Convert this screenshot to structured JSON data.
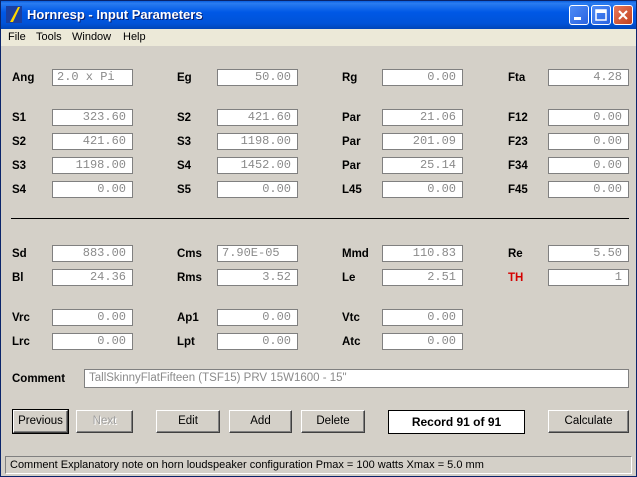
{
  "window": {
    "title": "Hornresp - Input Parameters"
  },
  "menu": [
    "File",
    "Tools",
    "Window",
    "Help"
  ],
  "rows": {
    "r1": [
      {
        "label": "Ang",
        "value": "2.0 x Pi",
        "align": "left"
      },
      {
        "label": "Eg",
        "value": "50.00"
      },
      {
        "label": "Rg",
        "value": "0.00"
      },
      {
        "label": "Fta",
        "value": "4.28"
      }
    ],
    "r2": [
      {
        "label": "S1",
        "value": "323.60"
      },
      {
        "label": "S2",
        "value": "421.60"
      },
      {
        "label": "Par",
        "value": "21.06"
      },
      {
        "label": "F12",
        "value": "0.00"
      }
    ],
    "r3": [
      {
        "label": "S2",
        "value": "421.60"
      },
      {
        "label": "S3",
        "value": "1198.00"
      },
      {
        "label": "Par",
        "value": "201.09"
      },
      {
        "label": "F23",
        "value": "0.00"
      }
    ],
    "r4": [
      {
        "label": "S3",
        "value": "1198.00"
      },
      {
        "label": "S4",
        "value": "1452.00"
      },
      {
        "label": "Par",
        "value": "25.14"
      },
      {
        "label": "F34",
        "value": "0.00"
      }
    ],
    "r5": [
      {
        "label": "S4",
        "value": "0.00"
      },
      {
        "label": "S5",
        "value": "0.00"
      },
      {
        "label": "L45",
        "value": "0.00"
      },
      {
        "label": "F45",
        "value": "0.00"
      }
    ],
    "r6": [
      {
        "label": "Sd",
        "value": "883.00"
      },
      {
        "label": "Cms",
        "value": "7.90E-05",
        "align": "left"
      },
      {
        "label": "Mmd",
        "value": "110.83"
      },
      {
        "label": "Re",
        "value": "5.50"
      }
    ],
    "r7": [
      {
        "label": "Bl",
        "value": "24.36"
      },
      {
        "label": "Rms",
        "value": "3.52"
      },
      {
        "label": "Le",
        "value": "2.51"
      },
      {
        "label": "TH",
        "value": "1",
        "red": true
      }
    ],
    "r8": [
      {
        "label": "Vrc",
        "value": "0.00"
      },
      {
        "label": "Ap1",
        "value": "0.00"
      },
      {
        "label": "Vtc",
        "value": "0.00"
      }
    ],
    "r9": [
      {
        "label": "Lrc",
        "value": "0.00"
      },
      {
        "label": "Lpt",
        "value": "0.00"
      },
      {
        "label": "Atc",
        "value": "0.00"
      }
    ]
  },
  "comment": {
    "label": "Comment",
    "value": "TallSkinnyFlatFifteen (TSF15)  PRV 15W1600  -  15\""
  },
  "buttons": {
    "previous": "Previous",
    "next": "Next",
    "edit": "Edit",
    "add": "Add",
    "delete": "Delete",
    "calculate": "Calculate"
  },
  "record": "Record 91 of 91",
  "status": "Comment   Explanatory note on horn loudspeaker configuration     Pmax = 100 watts    Xmax = 5.0 mm",
  "colors": {
    "title_bar": "#0054e3",
    "highlight_label": "#d40000",
    "field_text": "#8a8a8a"
  }
}
